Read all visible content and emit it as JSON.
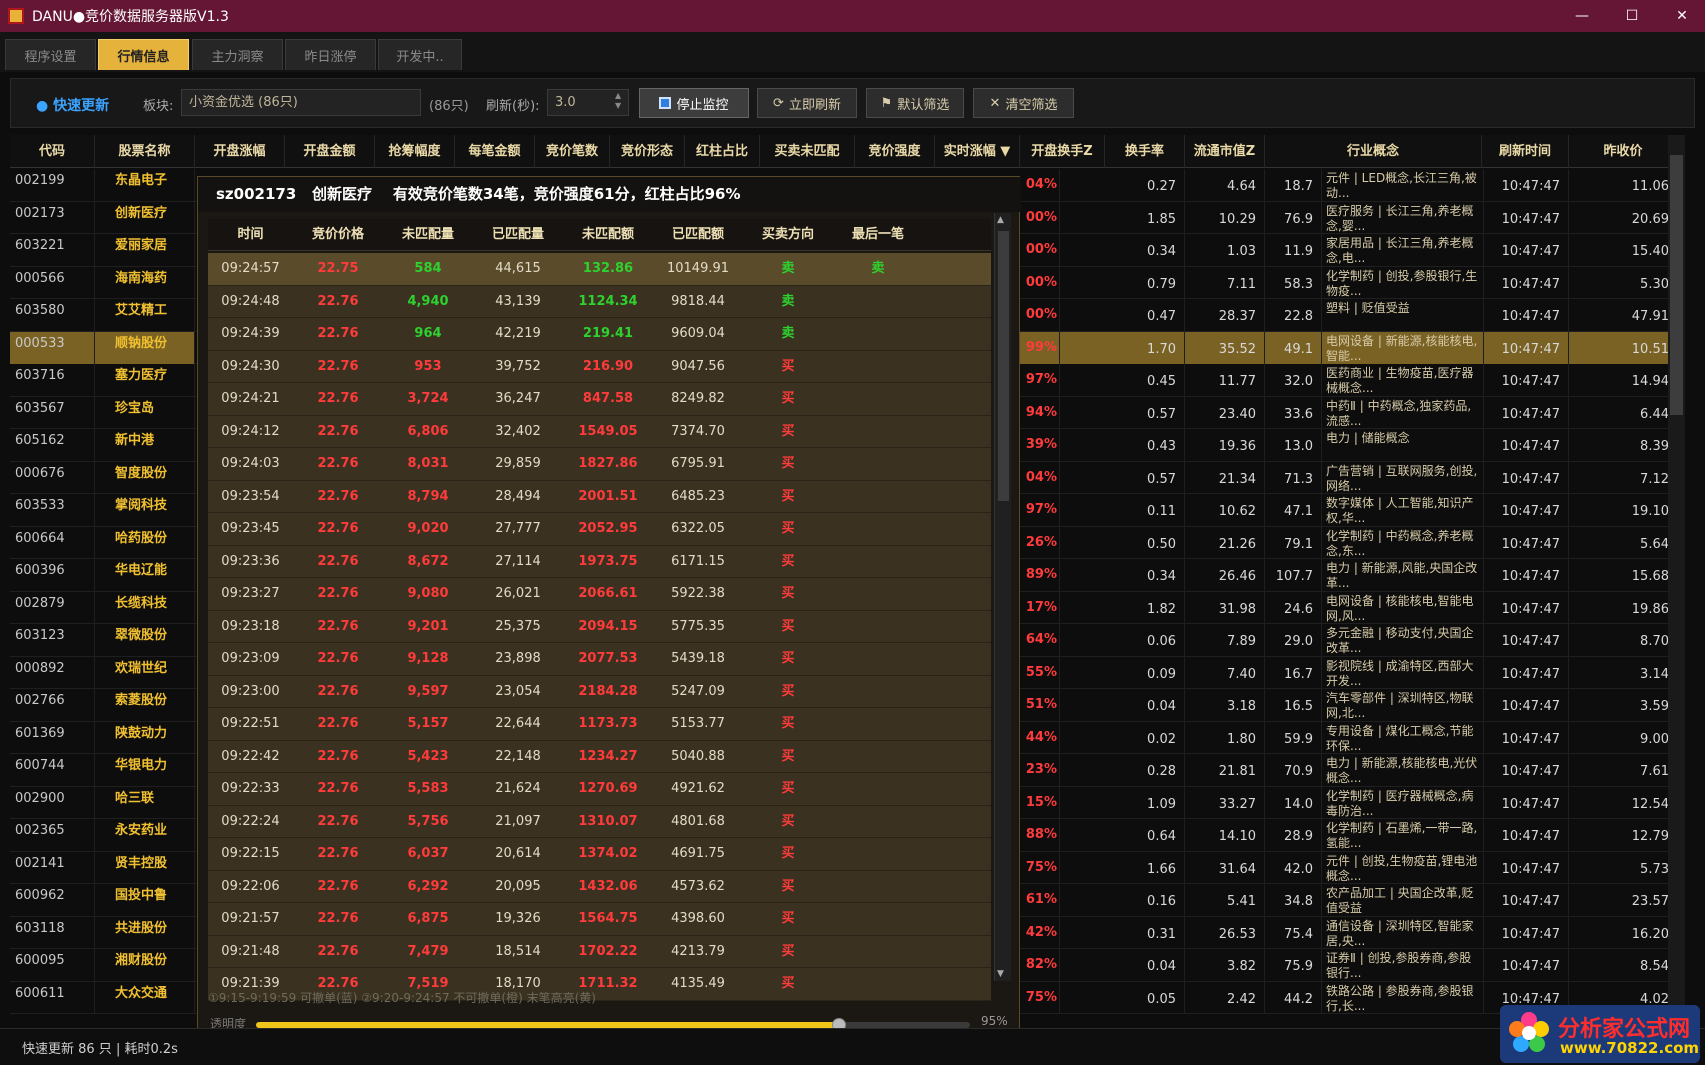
{
  "window": {
    "title": "DANU●竞价数据服务器版V1.3"
  },
  "tabs": [
    "程序设置",
    "行情信息",
    "主力洞察",
    "昨日涨停",
    "开发中.."
  ],
  "toolbar": {
    "fast_update": "● 快速更新",
    "board_label": "板块:",
    "board_value": "小资金优选 (86只)",
    "board_count": "(86只)",
    "refresh_label": "刷新(秒):",
    "refresh_value": "3.0",
    "btn_stop": "停止监控",
    "btn_refresh": "立即刷新",
    "btn_default_filter": "默认筛选",
    "btn_clear_filter": "清空筛选"
  },
  "grid": {
    "headers": [
      "代码",
      "股票名称",
      "开盘涨幅",
      "开盘金额",
      "抢筹幅度",
      "每笔金额",
      "竞价笔数",
      "竞价形态",
      "红柱占比",
      "买卖未匹配",
      "竞价强度",
      "实时涨幅 ▼",
      "开盘换手Z",
      "换手率",
      "流通市值Z",
      "行业概念",
      "刷新时间",
      "昨收价"
    ],
    "rows": [
      {
        "code": "002199",
        "name": "东晶电子",
        "pct": "04%",
        "z": "0.27",
        "hs": "4.64",
        "mv": "18.7",
        "ind": "元件 | LED概念,长江三角,被动...",
        "t": "10:47:47",
        "pc": "11.06"
      },
      {
        "code": "002173",
        "name": "创新医疗",
        "pct": "00%",
        "z": "1.85",
        "hs": "10.29",
        "mv": "76.9",
        "ind": "医疗服务 | 长江三角,养老概念,婴...",
        "t": "10:47:47",
        "pc": "20.69"
      },
      {
        "code": "603221",
        "name": "爱丽家居",
        "pct": "00%",
        "z": "0.34",
        "hs": "1.03",
        "mv": "11.9",
        "ind": "家居用品 | 长江三角,养老概念,电...",
        "t": "10:47:47",
        "pc": "15.40"
      },
      {
        "code": "000566",
        "name": "海南海药",
        "pct": "00%",
        "z": "0.79",
        "hs": "7.11",
        "mv": "58.3",
        "ind": "化学制药 | 创投,参股银行,生物疫...",
        "t": "10:47:47",
        "pc": "5.30"
      },
      {
        "code": "603580",
        "name": "艾艾精工",
        "pct": "00%",
        "z": "0.47",
        "hs": "28.37",
        "mv": "22.8",
        "ind": "塑料 | 贬值受益",
        "t": "10:47:47",
        "pc": "47.91"
      },
      {
        "code": "000533",
        "name": "顺钠股份",
        "pct": "99%",
        "z": "1.70",
        "hs": "35.52",
        "mv": "49.1",
        "ind": "电网设备 | 新能源,核能核电,智能...",
        "t": "10:47:47",
        "pc": "10.51"
      },
      {
        "code": "603716",
        "name": "塞力医疗",
        "pct": "97%",
        "z": "0.45",
        "hs": "11.77",
        "mv": "32.0",
        "ind": "医药商业 | 生物疫苗,医疗器械概念...",
        "t": "10:47:47",
        "pc": "14.94"
      },
      {
        "code": "603567",
        "name": "珍宝岛",
        "pct": "94%",
        "z": "0.57",
        "hs": "23.40",
        "mv": "33.6",
        "ind": "中药Ⅱ | 中药概念,独家药品,流感...",
        "t": "10:47:47",
        "pc": "6.44"
      },
      {
        "code": "605162",
        "name": "新中港",
        "pct": "39%",
        "z": "0.43",
        "hs": "19.36",
        "mv": "13.0",
        "ind": "电力 | 储能概念",
        "t": "10:47:47",
        "pc": "8.39"
      },
      {
        "code": "000676",
        "name": "智度股份",
        "pct": "04%",
        "z": "0.57",
        "hs": "21.34",
        "mv": "71.3",
        "ind": "广告营销 | 互联网服务,创投,网络...",
        "t": "10:47:47",
        "pc": "7.12"
      },
      {
        "code": "603533",
        "name": "掌阅科技",
        "pct": "97%",
        "z": "0.11",
        "hs": "10.62",
        "mv": "47.1",
        "ind": "数字媒体 | 人工智能,知识产权,华...",
        "t": "10:47:47",
        "pc": "19.10"
      },
      {
        "code": "600664",
        "name": "哈药股份",
        "pct": "26%",
        "z": "0.50",
        "hs": "21.26",
        "mv": "79.1",
        "ind": "化学制药 | 中药概念,养老概念,东...",
        "t": "10:47:47",
        "pc": "5.64"
      },
      {
        "code": "600396",
        "name": "华电辽能",
        "pct": "89%",
        "z": "0.34",
        "hs": "26.46",
        "mv": "107.7",
        "ind": "电力 | 新能源,风能,央国企改革...",
        "t": "10:47:47",
        "pc": "15.68"
      },
      {
        "code": "002879",
        "name": "长缆科技",
        "pct": "17%",
        "z": "1.82",
        "hs": "31.98",
        "mv": "24.6",
        "ind": "电网设备 | 核能核电,智能电网,风...",
        "t": "10:47:47",
        "pc": "19.86"
      },
      {
        "code": "603123",
        "name": "翠微股份",
        "pct": "64%",
        "z": "0.06",
        "hs": "7.89",
        "mv": "29.0",
        "ind": "多元金融 | 移动支付,央国企改革...",
        "t": "10:47:47",
        "pc": "8.70"
      },
      {
        "code": "000892",
        "name": "欢瑞世纪",
        "pct": "55%",
        "z": "0.09",
        "hs": "7.40",
        "mv": "16.7",
        "ind": "影视院线 | 成渝特区,西部大开发...",
        "t": "10:47:47",
        "pc": "3.14"
      },
      {
        "code": "002766",
        "name": "索菱股份",
        "pct": "51%",
        "z": "0.04",
        "hs": "3.18",
        "mv": "16.5",
        "ind": "汽车零部件 | 深圳特区,物联网,北...",
        "t": "10:47:47",
        "pc": "3.59"
      },
      {
        "code": "601369",
        "name": "陕鼓动力",
        "pct": "44%",
        "z": "0.02",
        "hs": "1.80",
        "mv": "59.9",
        "ind": "专用设备 | 煤化工概念,节能环保...",
        "t": "10:47:47",
        "pc": "9.00"
      },
      {
        "code": "600744",
        "name": "华银电力",
        "pct": "23%",
        "z": "0.28",
        "hs": "21.81",
        "mv": "70.9",
        "ind": "电力 | 新能源,核能核电,光伏概念...",
        "t": "10:47:47",
        "pc": "7.61"
      },
      {
        "code": "002900",
        "name": "哈三联",
        "pct": "15%",
        "z": "1.09",
        "hs": "33.27",
        "mv": "14.0",
        "ind": "化学制药 | 医疗器械概念,病毒防治...",
        "t": "10:47:47",
        "pc": "12.54"
      },
      {
        "code": "002365",
        "name": "永安药业",
        "pct": "88%",
        "z": "0.64",
        "hs": "14.10",
        "mv": "28.9",
        "ind": "化学制药 | 石墨烯,一带一路,氢能...",
        "t": "10:47:47",
        "pc": "12.79"
      },
      {
        "code": "002141",
        "name": "贤丰控股",
        "pct": "75%",
        "z": "1.66",
        "hs": "31.64",
        "mv": "42.0",
        "ind": "元件 | 创投,生物疫苗,锂电池概念...",
        "t": "10:47:47",
        "pc": "5.73"
      },
      {
        "code": "600962",
        "name": "国投中鲁",
        "pct": "61%",
        "z": "0.16",
        "hs": "5.41",
        "mv": "34.8",
        "ind": "农产品加工 | 央国企改革,贬值受益",
        "t": "10:47:47",
        "pc": "23.57"
      },
      {
        "code": "603118",
        "name": "共进股份",
        "pct": "42%",
        "z": "0.31",
        "hs": "26.53",
        "mv": "75.4",
        "ind": "通信设备 | 深圳特区,智能家居,央...",
        "t": "10:47:47",
        "pc": "16.20"
      },
      {
        "code": "600095",
        "name": "湘财股份",
        "pct": "82%",
        "z": "0.04",
        "hs": "3.82",
        "mv": "75.9",
        "ind": "证券Ⅱ | 创投,参股券商,参股银行...",
        "t": "10:47:47",
        "pc": "8.54"
      },
      {
        "code": "600611",
        "name": "大众交通",
        "pct": "75%",
        "z": "0.05",
        "hs": "2.42",
        "mv": "44.2",
        "ind": "铁路公路 | 参股券商,参股银行,长...",
        "t": "10:47:47",
        "pc": "4.02"
      }
    ]
  },
  "popup": {
    "title": "sz002173   创新医疗    有效竞价笔数34笔，竞价强度61分，红柱占比96%",
    "headers": [
      "时间",
      "竞价价格",
      "未匹配量",
      "已匹配量",
      "未匹配额",
      "已匹配额",
      "买卖方向",
      "最后一笔"
    ],
    "rows": [
      {
        "t": "09:24:57",
        "p": "22.75",
        "u": "584",
        "m": "44,615",
        "ua": "132.86",
        "ma": "10149.91",
        "d": "卖",
        "l": "卖",
        "c": "green"
      },
      {
        "t": "09:24:48",
        "p": "22.76",
        "u": "4,940",
        "m": "43,139",
        "ua": "1124.34",
        "ma": "9818.44",
        "d": "卖",
        "l": "",
        "c": "green"
      },
      {
        "t": "09:24:39",
        "p": "22.76",
        "u": "964",
        "m": "42,219",
        "ua": "219.41",
        "ma": "9609.04",
        "d": "卖",
        "l": "",
        "c": "green"
      },
      {
        "t": "09:24:30",
        "p": "22.76",
        "u": "953",
        "m": "39,752",
        "ua": "216.90",
        "ma": "9047.56",
        "d": "买",
        "l": "",
        "c": "red"
      },
      {
        "t": "09:24:21",
        "p": "22.76",
        "u": "3,724",
        "m": "36,247",
        "ua": "847.58",
        "ma": "8249.82",
        "d": "买",
        "l": "",
        "c": "red"
      },
      {
        "t": "09:24:12",
        "p": "22.76",
        "u": "6,806",
        "m": "32,402",
        "ua": "1549.05",
        "ma": "7374.70",
        "d": "买",
        "l": "",
        "c": "red"
      },
      {
        "t": "09:24:03",
        "p": "22.76",
        "u": "8,031",
        "m": "29,859",
        "ua": "1827.86",
        "ma": "6795.91",
        "d": "买",
        "l": "",
        "c": "red"
      },
      {
        "t": "09:23:54",
        "p": "22.76",
        "u": "8,794",
        "m": "28,494",
        "ua": "2001.51",
        "ma": "6485.23",
        "d": "买",
        "l": "",
        "c": "red"
      },
      {
        "t": "09:23:45",
        "p": "22.76",
        "u": "9,020",
        "m": "27,777",
        "ua": "2052.95",
        "ma": "6322.05",
        "d": "买",
        "l": "",
        "c": "red"
      },
      {
        "t": "09:23:36",
        "p": "22.76",
        "u": "8,672",
        "m": "27,114",
        "ua": "1973.75",
        "ma": "6171.15",
        "d": "买",
        "l": "",
        "c": "red"
      },
      {
        "t": "09:23:27",
        "p": "22.76",
        "u": "9,080",
        "m": "26,021",
        "ua": "2066.61",
        "ma": "5922.38",
        "d": "买",
        "l": "",
        "c": "red"
      },
      {
        "t": "09:23:18",
        "p": "22.76",
        "u": "9,201",
        "m": "25,375",
        "ua": "2094.15",
        "ma": "5775.35",
        "d": "买",
        "l": "",
        "c": "red"
      },
      {
        "t": "09:23:09",
        "p": "22.76",
        "u": "9,128",
        "m": "23,898",
        "ua": "2077.53",
        "ma": "5439.18",
        "d": "买",
        "l": "",
        "c": "red"
      },
      {
        "t": "09:23:00",
        "p": "22.76",
        "u": "9,597",
        "m": "23,054",
        "ua": "2184.28",
        "ma": "5247.09",
        "d": "买",
        "l": "",
        "c": "red"
      },
      {
        "t": "09:22:51",
        "p": "22.76",
        "u": "5,157",
        "m": "22,644",
        "ua": "1173.73",
        "ma": "5153.77",
        "d": "买",
        "l": "",
        "c": "red"
      },
      {
        "t": "09:22:42",
        "p": "22.76",
        "u": "5,423",
        "m": "22,148",
        "ua": "1234.27",
        "ma": "5040.88",
        "d": "买",
        "l": "",
        "c": "red"
      },
      {
        "t": "09:22:33",
        "p": "22.76",
        "u": "5,583",
        "m": "21,624",
        "ua": "1270.69",
        "ma": "4921.62",
        "d": "买",
        "l": "",
        "c": "red"
      },
      {
        "t": "09:22:24",
        "p": "22.76",
        "u": "5,756",
        "m": "21,097",
        "ua": "1310.07",
        "ma": "4801.68",
        "d": "买",
        "l": "",
        "c": "red"
      },
      {
        "t": "09:22:15",
        "p": "22.76",
        "u": "6,037",
        "m": "20,614",
        "ua": "1374.02",
        "ma": "4691.75",
        "d": "买",
        "l": "",
        "c": "red"
      },
      {
        "t": "09:22:06",
        "p": "22.76",
        "u": "6,292",
        "m": "20,095",
        "ua": "1432.06",
        "ma": "4573.62",
        "d": "买",
        "l": "",
        "c": "red"
      },
      {
        "t": "09:21:57",
        "p": "22.76",
        "u": "6,875",
        "m": "19,326",
        "ua": "1564.75",
        "ma": "4398.60",
        "d": "买",
        "l": "",
        "c": "red"
      },
      {
        "t": "09:21:48",
        "p": "22.76",
        "u": "7,479",
        "m": "18,514",
        "ua": "1702.22",
        "ma": "4213.79",
        "d": "买",
        "l": "",
        "c": "red"
      },
      {
        "t": "09:21:39",
        "p": "22.76",
        "u": "7,519",
        "m": "18,170",
        "ua": "1711.32",
        "ma": "4135.49",
        "d": "买",
        "l": "",
        "c": "red"
      }
    ],
    "footnote": "①9:15-9:19:59 可撤单(蓝)   ②9:20-9:24:57 不可撤单(橙)   末笔高亮(黄)",
    "opacity_label": "透明度",
    "opacity_value": "95%",
    "opacity_level": 0.95
  },
  "status": {
    "text": "快速更新 86 只 | 耗时0.2s"
  },
  "logo": {
    "line1": "分析家公式网",
    "line2": "www.70822.com"
  },
  "colors": {
    "accent": "#e5b23c",
    "up_red": "#ff3b3b",
    "down_green": "#2ed12e",
    "title_bar": "#641634"
  }
}
